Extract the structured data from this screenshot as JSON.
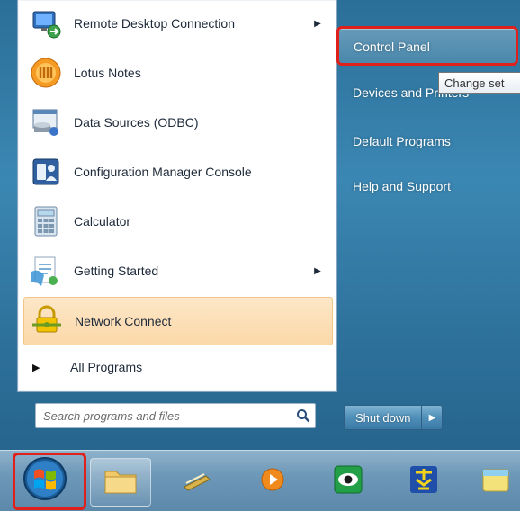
{
  "start_menu": {
    "programs": [
      {
        "label": "Remote Desktop Connection",
        "icon": "remote-desktop-icon",
        "has_submenu": true
      },
      {
        "label": "Lotus Notes",
        "icon": "lotus-notes-icon",
        "has_submenu": false
      },
      {
        "label": "Data Sources (ODBC)",
        "icon": "data-sources-icon",
        "has_submenu": false
      },
      {
        "label": "Configuration Manager Console",
        "icon": "config-manager-icon",
        "has_submenu": false
      },
      {
        "label": "Calculator",
        "icon": "calculator-icon",
        "has_submenu": false
      },
      {
        "label": "Getting Started",
        "icon": "getting-started-icon",
        "has_submenu": true
      },
      {
        "label": "Network Connect",
        "icon": "network-connect-icon",
        "has_submenu": false,
        "highlighted": true
      }
    ],
    "all_programs_label": "All Programs",
    "search_placeholder": "Search programs and files",
    "right_items": [
      {
        "label": "Control Panel"
      },
      {
        "label": "Devices and Printers"
      },
      {
        "label": "Default Programs"
      },
      {
        "label": "Help and Support"
      }
    ],
    "tooltip": "Change set",
    "shutdown_label": "Shut down"
  },
  "taskbar": {
    "items": [
      {
        "name": "start-orb",
        "icon": "windows-orb-icon"
      },
      {
        "name": "explorer",
        "icon": "folder-icon"
      },
      {
        "name": "wand-app",
        "icon": "wand-icon"
      },
      {
        "name": "media-player",
        "icon": "media-player-icon"
      },
      {
        "name": "eye-app",
        "icon": "eye-icon"
      },
      {
        "name": "char-app",
        "icon": "kanji-app-icon"
      },
      {
        "name": "extra",
        "icon": "app-icon"
      }
    ]
  },
  "colors": {
    "annotation_red": "#e0201a",
    "highlight_orange": "#fbd8a8",
    "menu_blue": "#2c6f98"
  }
}
